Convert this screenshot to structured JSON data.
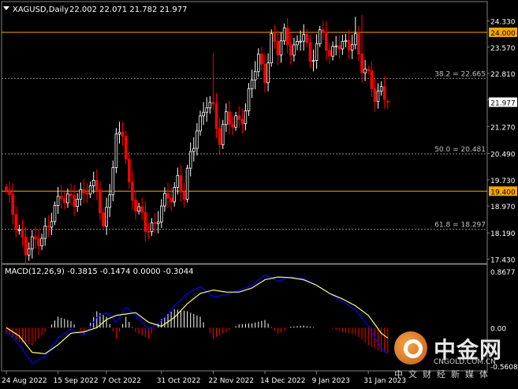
{
  "header": {
    "symbol": "XAGUSD,Daily",
    "ohlc": "22.002 22.071 21.782 21.977"
  },
  "price_axis": {
    "ticks": [
      "24.330",
      "23.570",
      "22.810",
      "22.050",
      "21.270",
      "20.490",
      "19.730",
      "18.970",
      "18.190",
      "17.430"
    ],
    "hline_labels": [
      "24.000",
      "19.400"
    ],
    "current_label": "21.977"
  },
  "fib_labels": [
    "38.2 = 22.665",
    "50.0 = 20.481",
    "61.8 = 18.297"
  ],
  "macd": {
    "title": "MACD(12,26,9) -0.3815 -0.1474 0.0000 -0.3044",
    "ticks": [
      "0.8677",
      "0.00",
      "-0.5608"
    ]
  },
  "time_axis": {
    "labels": [
      "24 Aug 2022",
      "15 Sep 2022",
      "7 Oct 2022",
      "31 Oct 2022",
      "22 Nov 2022",
      "14 Dec 2022",
      "9 Jan 2023",
      "31 Jan 2023"
    ]
  },
  "watermark": {
    "cn": "中金网",
    "site": "CNGOLD.COM.CN",
    "sub": "中文财经新媒体"
  },
  "colors": {
    "background": "#000000",
    "bull": "#ffffff",
    "bear": "#ff0000",
    "hline": "#ffa500",
    "macd_main": "#0000ff",
    "macd_signal": "#ffff80",
    "grid": "#808080"
  },
  "chart_data": [
    {
      "type": "candlestick",
      "title": "XAGUSD,Daily",
      "ylim": [
        17.3,
        24.6
      ],
      "x_labels": [
        "24 Aug 2022",
        "15 Sep 2022",
        "7 Oct 2022",
        "31 Oct 2022",
        "22 Nov 2022",
        "14 Dec 2022",
        "9 Jan 2023",
        "31 Jan 2023"
      ],
      "close_path": [
        [
          0,
          19.3
        ],
        [
          4,
          18.3
        ],
        [
          6,
          17.6
        ],
        [
          10,
          18.1
        ],
        [
          13,
          18.3
        ],
        [
          17,
          19.4
        ],
        [
          21,
          19.0
        ],
        [
          25,
          19.6
        ],
        [
          28,
          19.4
        ],
        [
          30,
          18.3
        ],
        [
          34,
          20.8
        ],
        [
          36,
          21.1
        ],
        [
          38,
          19.6
        ],
        [
          40,
          19.0
        ],
        [
          43,
          18.3
        ],
        [
          46,
          18.5
        ],
        [
          48,
          18.9
        ],
        [
          51,
          19.3
        ],
        [
          53,
          19.8
        ],
        [
          55,
          19.2
        ],
        [
          57,
          20.4
        ],
        [
          59,
          21.3
        ],
        [
          62,
          21.9
        ],
        [
          64,
          21.7
        ],
        [
          66,
          21.0
        ],
        [
          68,
          21.6
        ],
        [
          70,
          21.2
        ],
        [
          72,
          21.5
        ],
        [
          74,
          21.8
        ],
        [
          76,
          22.6
        ],
        [
          78,
          23.2
        ],
        [
          80,
          22.8
        ],
        [
          82,
          23.8
        ],
        [
          84,
          23.4
        ],
        [
          86,
          24.0
        ],
        [
          88,
          23.6
        ],
        [
          90,
          23.5
        ],
        [
          92,
          24.0
        ],
        [
          94,
          23.2
        ],
        [
          96,
          23.7
        ],
        [
          98,
          23.9
        ],
        [
          100,
          23.3
        ],
        [
          102,
          23.8
        ],
        [
          104,
          23.5
        ],
        [
          106,
          23.6
        ],
        [
          108,
          23.9
        ],
        [
          110,
          23.0
        ],
        [
          112,
          22.6
        ],
        [
          114,
          22.2
        ],
        [
          116,
          22.4
        ],
        [
          118,
          22.0
        ]
      ],
      "spikes": [
        [
          8,
          17.45
        ],
        [
          37,
          20.6
        ],
        [
          64,
          23.4
        ],
        [
          108,
          24.45
        ],
        [
          110,
          24.5
        ]
      ],
      "last": {
        "open": 22.002,
        "high": 22.071,
        "low": 21.782,
        "close": 21.977
      },
      "horizontal_lines": [
        24.0,
        19.4
      ],
      "fibonacci": [
        {
          "level": "38.2",
          "price": 22.665
        },
        {
          "level": "50.0",
          "price": 20.481
        },
        {
          "level": "61.8",
          "price": 18.297
        }
      ]
    },
    {
      "type": "macd",
      "params": [
        12,
        26,
        9
      ],
      "readout": [
        -0.3815,
        -0.1474,
        0.0,
        -0.3044
      ],
      "ylim": [
        -0.5608,
        0.8677
      ],
      "main": [
        [
          0,
          -0.05
        ],
        [
          4,
          -0.25
        ],
        [
          8,
          -0.52
        ],
        [
          12,
          -0.42
        ],
        [
          16,
          -0.15
        ],
        [
          20,
          -0.02
        ],
        [
          24,
          -0.12
        ],
        [
          28,
          0.15
        ],
        [
          31,
          0.22
        ],
        [
          34,
          0.08
        ],
        [
          37,
          0.3
        ],
        [
          40,
          0.18
        ],
        [
          44,
          -0.02
        ],
        [
          48,
          0.1
        ],
        [
          52,
          0.32
        ],
        [
          56,
          0.5
        ],
        [
          60,
          0.6
        ],
        [
          64,
          0.45
        ],
        [
          68,
          0.48
        ],
        [
          72,
          0.55
        ],
        [
          76,
          0.62
        ],
        [
          80,
          0.77
        ],
        [
          84,
          0.68
        ],
        [
          88,
          0.74
        ],
        [
          92,
          0.72
        ],
        [
          96,
          0.62
        ],
        [
          100,
          0.5
        ],
        [
          104,
          0.38
        ],
        [
          108,
          0.26
        ],
        [
          112,
          0.02
        ],
        [
          116,
          -0.3
        ],
        [
          118,
          -0.38
        ]
      ],
      "signal": [
        [
          0,
          0.0
        ],
        [
          4,
          -0.12
        ],
        [
          8,
          -0.36
        ],
        [
          12,
          -0.38
        ],
        [
          16,
          -0.25
        ],
        [
          20,
          -0.08
        ],
        [
          24,
          -0.06
        ],
        [
          28,
          0.0
        ],
        [
          31,
          0.12
        ],
        [
          34,
          0.18
        ],
        [
          37,
          0.2
        ],
        [
          40,
          0.22
        ],
        [
          44,
          0.08
        ],
        [
          48,
          0.02
        ],
        [
          52,
          0.15
        ],
        [
          56,
          0.35
        ],
        [
          60,
          0.5
        ],
        [
          64,
          0.55
        ],
        [
          68,
          0.52
        ],
        [
          72,
          0.52
        ],
        [
          76,
          0.58
        ],
        [
          80,
          0.7
        ],
        [
          84,
          0.74
        ],
        [
          88,
          0.73
        ],
        [
          92,
          0.7
        ],
        [
          96,
          0.62
        ],
        [
          100,
          0.5
        ],
        [
          104,
          0.42
        ],
        [
          108,
          0.32
        ],
        [
          112,
          0.18
        ],
        [
          116,
          -0.08
        ],
        [
          118,
          -0.15
        ]
      ]
    }
  ]
}
